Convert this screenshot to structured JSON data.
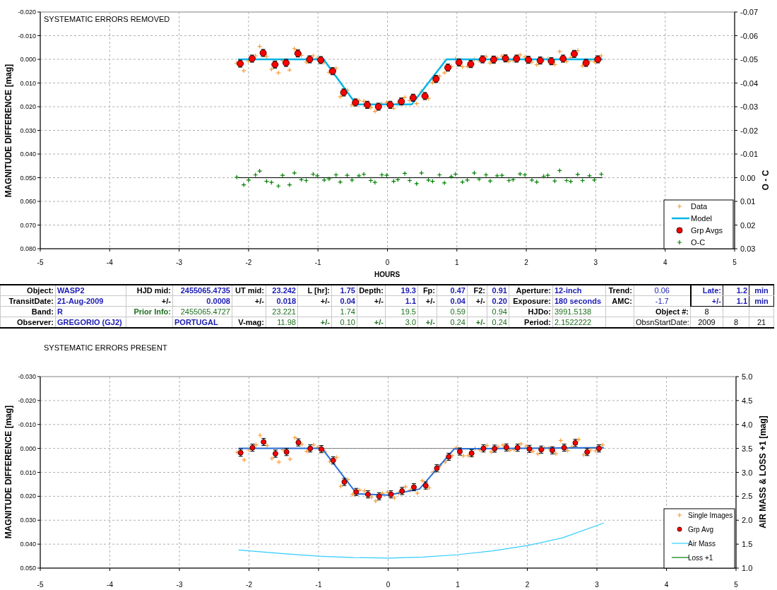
{
  "charts": [
    {
      "chart_data": {
        "type": "scatter",
        "title": "SYSTEMATIC ERRORS REMOVED",
        "xlabel": "HOURS",
        "ylabel": "MAGNITUDE DIFFERENCE [mag]",
        "y2label": "O - C",
        "xlim": [
          -5,
          5
        ],
        "ylim": [
          0.08,
          -0.02
        ],
        "y2lim": [
          0.03,
          -0.07
        ],
        "grid": true,
        "legend": true,
        "xticks": [
          -5,
          -4,
          -3,
          -2,
          -1,
          0,
          1,
          2,
          3,
          4,
          5
        ],
        "yticks": [
          {
            "value": -0.02,
            "label": "-0.020"
          },
          {
            "value": -0.01,
            "label": "-0.010"
          },
          {
            "value": 0,
            "label": "0.000"
          },
          {
            "value": 0.01,
            "label": "0.010"
          },
          {
            "value": 0.02,
            "label": "0.020"
          },
          {
            "value": 0.03,
            "label": "0.030"
          },
          {
            "value": 0.04,
            "label": "0.040"
          },
          {
            "value": 0.05,
            "label": "0.050"
          },
          {
            "value": 0.06,
            "label": "0.060"
          },
          {
            "value": 0.07,
            "label": "0.070"
          },
          {
            "value": 0.08,
            "label": "0.080"
          }
        ],
        "y2ticks": [
          {
            "value": -0.07,
            "label": "-0.07"
          },
          {
            "value": -0.06,
            "label": "-0.06"
          },
          {
            "value": -0.05,
            "label": "-0.05"
          },
          {
            "value": -0.04,
            "label": "-0.04"
          },
          {
            "value": -0.03,
            "label": "-0.03"
          },
          {
            "value": -0.02,
            "label": "-0.02"
          },
          {
            "value": -0.01,
            "label": "-0.01"
          },
          {
            "value": 0,
            "label": "0.00"
          },
          {
            "value": 0.01,
            "label": "0.01"
          },
          {
            "value": 0.02,
            "label": "0.02"
          },
          {
            "value": 0.03,
            "label": "0.03"
          }
        ],
        "series": [
          {
            "type": "line",
            "color": "#000000",
            "axis": "y2",
            "x": [
              -2.15,
              3.1
            ],
            "values": [
              0,
              0
            ]
          },
          {
            "name": "Data",
            "type": "scatter",
            "marker": "plus",
            "color": "#ff9933",
            "axis": "y",
            "x": [
              -2.17,
              -2.07,
              -2.0,
              -1.9,
              -1.84,
              -1.74,
              -1.67,
              -1.57,
              -1.51,
              -1.41,
              -1.34,
              -1.24,
              -1.17,
              -1.07,
              -1.01,
              -0.91,
              -0.84,
              -0.74,
              -0.68,
              -0.58,
              -0.51,
              -0.41,
              -0.34,
              -0.24,
              -0.18,
              -0.08,
              -0.01,
              0.09,
              0.15,
              0.25,
              0.32,
              0.42,
              0.49,
              0.59,
              0.65,
              0.75,
              0.82,
              0.92,
              0.98,
              1.08,
              1.15,
              1.25,
              1.32,
              1.42,
              1.48,
              1.58,
              1.65,
              1.75,
              1.81,
              1.91,
              1.98,
              2.08,
              2.15,
              2.25,
              2.31,
              2.41,
              2.48,
              2.58,
              2.64,
              2.74,
              2.81,
              2.91,
              2.98,
              3.08
            ],
            "values": [
              0.0016,
              0.0048,
              0.0007,
              -0.0015,
              -0.0055,
              -0.0012,
              0.0042,
              0.0057,
              0.0005,
              0.0045,
              -0.0045,
              -0.0017,
              0.0012,
              -0.0015,
              -0.0005,
              0.0013,
              0.0055,
              0.0038,
              0.0158,
              0.013,
              0.0192,
              0.0174,
              0.0177,
              0.0204,
              0.022,
              0.0188,
              0.0182,
              0.0207,
              0.0186,
              0.016,
              0.0174,
              0.0187,
              0.0135,
              0.0165,
              0.0098,
              0.0071,
              0.0057,
              0.003,
              -0.0002,
              0.0031,
              0.003,
              0.0,
              0.0006,
              -0.0012,
              0.0015,
              -0.0007,
              -0.0014,
              0.0008,
              0.0005,
              -0.0019,
              -0.001,
              0.0012,
              0.0023,
              -0.0001,
              -0.0002,
              0.0022,
              -0.0033,
              0.0009,
              -0.0007,
              -0.0037,
              0.0027,
              0.0007,
              0.001,
              -0.0015
            ]
          },
          {
            "name": "Model",
            "type": "line",
            "color": "#00b4e6",
            "axis": "y",
            "x": [
              -2.15,
              -0.92,
              -0.45,
              0.35,
              0.85,
              3.1
            ],
            "values": [
              0,
              0,
              0.019,
              0.019,
              0,
              0
            ]
          },
          {
            "name": "Grp Avgs",
            "type": "scatter",
            "marker": "circle",
            "color": "#ff0000",
            "axis": "y",
            "x": [
              -2.12,
              -1.95,
              -1.79,
              -1.62,
              -1.46,
              -1.29,
              -1.12,
              -0.96,
              -0.79,
              -0.63,
              -0.46,
              -0.29,
              -0.13,
              0.04,
              0.2,
              0.37,
              0.54,
              0.7,
              0.87,
              1.03,
              1.2,
              1.37,
              1.53,
              1.7,
              1.86,
              2.03,
              2.2,
              2.36,
              2.53,
              2.69,
              2.86,
              3.03
            ],
            "values": [
              0.0018,
              -0.0003,
              -0.0027,
              0.0022,
              0.0015,
              -0.0025,
              0.0,
              0.0003,
              0.005,
              0.014,
              0.0182,
              0.0192,
              0.02,
              0.0192,
              0.0178,
              0.0162,
              0.0155,
              0.0083,
              0.0035,
              0.0013,
              0.002,
              0.0,
              0.0001,
              -0.0004,
              -0.0003,
              0.0002,
              0.0005,
              0.0008,
              -0.0003,
              -0.0023,
              0.0015,
              0.0
            ]
          },
          {
            "name": "O-C",
            "type": "scatter",
            "marker": "plus",
            "color": "#008000",
            "axis": "y2",
            "x": [
              -2.17,
              -2.07,
              -2.0,
              -1.9,
              -1.84,
              -1.74,
              -1.67,
              -1.57,
              -1.51,
              -1.41,
              -1.34,
              -1.24,
              -1.17,
              -1.07,
              -1.01,
              -0.91,
              -0.84,
              -0.74,
              -0.68,
              -0.58,
              -0.51,
              -0.41,
              -0.34,
              -0.24,
              -0.18,
              -0.08,
              -0.01,
              0.09,
              0.15,
              0.25,
              0.32,
              0.42,
              0.49,
              0.59,
              0.65,
              0.75,
              0.82,
              0.92,
              0.98,
              1.08,
              1.15,
              1.25,
              1.32,
              1.42,
              1.48,
              1.58,
              1.65,
              1.75,
              1.81,
              1.91,
              1.98,
              2.08,
              2.15,
              2.25,
              2.31,
              2.41,
              2.48,
              2.58,
              2.64,
              2.74,
              2.81,
              2.91,
              2.98,
              3.08
            ],
            "values": [
              -0.0002,
              0.003,
              0.001,
              -0.0012,
              -0.0028,
              0.0015,
              0.002,
              0.0035,
              -0.001,
              0.003,
              -0.002,
              0.0008,
              0.0012,
              -0.0015,
              -0.0008,
              0.001,
              0.0005,
              -0.0012,
              0.0018,
              -0.001,
              0.001,
              -0.0008,
              -0.0015,
              0.0012,
              0.002,
              -0.0012,
              -0.001,
              0.0015,
              0.0008,
              -0.0018,
              0.0012,
              0.0025,
              -0.002,
              0.001,
              0.0015,
              -0.0012,
              0.0022,
              -0.0005,
              -0.0015,
              0.0018,
              0.001,
              -0.002,
              0.0006,
              -0.0012,
              0.0014,
              -0.0008,
              -0.001,
              0.0012,
              0.0008,
              -0.0016,
              -0.0012,
              0.001,
              0.0018,
              -0.0006,
              -0.001,
              0.0014,
              -0.003,
              0.0012,
              0.0016,
              -0.0014,
              0.0012,
              -0.0008,
              0.001,
              -0.0015
            ]
          }
        ]
      }
    },
    {
      "chart_data": {
        "type": "scatter",
        "title": "SYSTEMATIC ERRORS PRESENT",
        "ylabel": "MAGNITUDE DIFFERENCE [mag]",
        "y2label": "AIR MASS & LOSS +1 [mag]",
        "xlim": [
          -5,
          5
        ],
        "ylim": [
          0.05,
          -0.03
        ],
        "y2lim": [
          1,
          5
        ],
        "grid": true,
        "legend": true,
        "xticks": [
          -5,
          -4,
          -3,
          -2,
          -1,
          0,
          1,
          2,
          3,
          4,
          5
        ],
        "yticks": [
          {
            "value": -0.03,
            "label": "-0.030"
          },
          {
            "value": -0.02,
            "label": "-0.020"
          },
          {
            "value": -0.01,
            "label": "-0.010"
          },
          {
            "value": 0,
            "label": "0.000"
          },
          {
            "value": 0.01,
            "label": "0.010"
          },
          {
            "value": 0.02,
            "label": "0.020"
          },
          {
            "value": 0.03,
            "label": "0.030"
          },
          {
            "value": 0.04,
            "label": "0.040"
          },
          {
            "value": 0.05,
            "label": "0.050"
          }
        ],
        "y2ticks": [
          {
            "value": 5,
            "label": "5.0"
          },
          {
            "value": 4.5,
            "label": "4.5"
          },
          {
            "value": 4,
            "label": "4.0"
          },
          {
            "value": 3.5,
            "label": "3.5"
          },
          {
            "value": 3,
            "label": "3.0"
          },
          {
            "value": 2.5,
            "label": "2.5"
          },
          {
            "value": 2,
            "label": "2.0"
          },
          {
            "value": 1.5,
            "label": "1.5"
          },
          {
            "value": 1,
            "label": "1.0"
          }
        ],
        "series": [
          {
            "type": "line",
            "color": "#808080",
            "axis": "y",
            "x": [
              -2.15,
              3.1
            ],
            "values": [
              0,
              0
            ]
          },
          {
            "name": "Single Images",
            "type": "scatter",
            "marker": "plus",
            "color": "#ff9933",
            "axis": "y",
            "x": [
              -2.17,
              -2.07,
              -2.0,
              -1.9,
              -1.84,
              -1.74,
              -1.67,
              -1.57,
              -1.51,
              -1.41,
              -1.34,
              -1.24,
              -1.17,
              -1.07,
              -1.01,
              -0.91,
              -0.84,
              -0.74,
              -0.68,
              -0.58,
              -0.51,
              -0.41,
              -0.34,
              -0.24,
              -0.18,
              -0.08,
              -0.01,
              0.09,
              0.15,
              0.25,
              0.32,
              0.42,
              0.49,
              0.59,
              0.65,
              0.75,
              0.82,
              0.92,
              0.98,
              1.08,
              1.15,
              1.25,
              1.32,
              1.42,
              1.48,
              1.58,
              1.65,
              1.75,
              1.81,
              1.91,
              1.98,
              2.08,
              2.15,
              2.25,
              2.31,
              2.41,
              2.48,
              2.58,
              2.64,
              2.74,
              2.81,
              2.91,
              2.98,
              3.08
            ],
            "values": [
              0.0016,
              0.0048,
              0.0007,
              -0.0015,
              -0.0055,
              -0.0012,
              0.0042,
              0.0057,
              0.0005,
              0.0045,
              -0.0045,
              -0.0017,
              0.0012,
              -0.0015,
              -0.0005,
              0.0013,
              0.0055,
              0.0038,
              0.0158,
              0.013,
              0.0192,
              0.0174,
              0.0177,
              0.0204,
              0.022,
              0.0188,
              0.0182,
              0.0207,
              0.0186,
              0.016,
              0.0174,
              0.0187,
              0.0135,
              0.0165,
              0.0098,
              0.0071,
              0.0057,
              0.003,
              -0.0002,
              0.0031,
              0.003,
              0.0,
              0.0006,
              -0.0012,
              0.0015,
              -0.0007,
              -0.0014,
              0.0008,
              0.0005,
              -0.0019,
              -0.001,
              0.0012,
              0.0023,
              -0.0001,
              -0.0002,
              0.0022,
              -0.0033,
              0.0009,
              -0.0007,
              -0.0037,
              0.0027,
              0.0007,
              0.001,
              -0.0015
            ]
          },
          {
            "type": "line",
            "color": "#2a6fd6",
            "axis": "y",
            "x": [
              -2.15,
              -0.95,
              -0.45,
              0.0,
              0.45,
              0.95,
              3.1
            ],
            "values": [
              0,
              0,
              0.019,
              0.0195,
              0.017,
              0.0002,
              -0.0003
            ]
          },
          {
            "name": "Grp Avg",
            "type": "scatter",
            "marker": "circle",
            "color": "#ff0000",
            "axis": "y",
            "x": [
              -2.12,
              -1.95,
              -1.79,
              -1.62,
              -1.46,
              -1.29,
              -1.12,
              -0.96,
              -0.79,
              -0.63,
              -0.46,
              -0.29,
              -0.13,
              0.04,
              0.2,
              0.37,
              0.54,
              0.7,
              0.87,
              1.03,
              1.2,
              1.37,
              1.53,
              1.7,
              1.86,
              2.03,
              2.2,
              2.36,
              2.53,
              2.69,
              2.86,
              3.03
            ],
            "values": [
              0.0018,
              -0.0003,
              -0.0027,
              0.0022,
              0.0015,
              -0.0025,
              0.0,
              0.0003,
              0.005,
              0.014,
              0.0182,
              0.0192,
              0.02,
              0.0192,
              0.0178,
              0.0162,
              0.0155,
              0.0083,
              0.0035,
              0.0013,
              0.002,
              0.0,
              0.0001,
              -0.0004,
              -0.0003,
              0.0002,
              0.0005,
              0.0008,
              -0.0003,
              -0.0023,
              0.0015,
              0.0
            ]
          },
          {
            "name": "Air Mass",
            "type": "line",
            "color": "#33ccff",
            "axis": "y2",
            "x": [
              -2.15,
              -1.5,
              -1,
              -0.5,
              0,
              0.5,
              1,
              1.5,
              2,
              2.5,
              3.1
            ],
            "values": [
              1.38,
              1.3,
              1.25,
              1.22,
              1.21,
              1.23,
              1.28,
              1.36,
              1.47,
              1.63,
              1.94
            ]
          },
          {
            "name": "Loss +1",
            "type": "line",
            "color": "#008000"
          }
        ]
      }
    }
  ],
  "table": {
    "rows": [
      [
        {
          "text": "Object:",
          "kind": "label"
        },
        {
          "text": "WASP2",
          "kind": "text"
        },
        {
          "text": "HJD mid:",
          "kind": "label"
        },
        {
          "text": "2455065.4735",
          "kind": "value"
        },
        {
          "text": "UT mid:",
          "kind": "label"
        },
        {
          "text": "23.242",
          "kind": "value"
        },
        {
          "text": "L [hr]:",
          "kind": "label"
        },
        {
          "text": "1.75",
          "kind": "value"
        },
        {
          "text": "Depth:",
          "kind": "label"
        },
        {
          "text": "19.3",
          "kind": "value"
        },
        {
          "text": "Fp:",
          "kind": "label"
        },
        {
          "text": "0.47",
          "kind": "value"
        },
        {
          "text": "F2:",
          "kind": "label"
        },
        {
          "text": "0.91",
          "kind": "value"
        },
        {
          "text": "Aperture:",
          "kind": "label"
        },
        {
          "text": "12-inch",
          "kind": "text"
        },
        {
          "text": "Trend:",
          "kind": "label"
        },
        {
          "text": "0.06",
          "kind": "plain_blue"
        },
        {
          "text": "Late:",
          "kind": "blue_label"
        },
        {
          "text": "1.2",
          "kind": "value"
        },
        {
          "text": "min",
          "kind": "unit"
        }
      ],
      [
        {
          "text": "TransitDate:",
          "kind": "label"
        },
        {
          "text": "21-Aug-2009",
          "kind": "text"
        },
        {
          "text": "+/-",
          "kind": "label"
        },
        {
          "text": "0.0008",
          "kind": "value"
        },
        {
          "text": "+/-",
          "kind": "label"
        },
        {
          "text": "0.018",
          "kind": "value"
        },
        {
          "text": "+/-",
          "kind": "label"
        },
        {
          "text": "0.04",
          "kind": "value"
        },
        {
          "text": "+/-",
          "kind": "label"
        },
        {
          "text": "1.1",
          "kind": "value"
        },
        {
          "text": "+/-",
          "kind": "label"
        },
        {
          "text": "0.04",
          "kind": "value"
        },
        {
          "text": "+/-",
          "kind": "label"
        },
        {
          "text": "0.20",
          "kind": "value"
        },
        {
          "text": "Exposure:",
          "kind": "label"
        },
        {
          "text": "180 seconds",
          "kind": "text"
        },
        {
          "text": "AMC:",
          "kind": "label"
        },
        {
          "text": "-1.7",
          "kind": "plain_blue"
        },
        {
          "text": "+/-",
          "kind": "blue_label"
        },
        {
          "text": "1.1",
          "kind": "value"
        },
        {
          "text": "min",
          "kind": "unit"
        }
      ],
      [
        {
          "text": "Band:",
          "kind": "label"
        },
        {
          "text": "R",
          "kind": "text"
        },
        {
          "text": "Prior Info:",
          "kind": "prior_label"
        },
        {
          "text": "2455065.4727",
          "kind": "prior"
        },
        {
          "kind": "blank"
        },
        {
          "text": "23.221",
          "kind": "prior"
        },
        {
          "kind": "blank"
        },
        {
          "text": "1.74",
          "kind": "prior"
        },
        {
          "kind": "blank"
        },
        {
          "text": "19.5",
          "kind": "prior"
        },
        {
          "kind": "blank"
        },
        {
          "text": "0.59",
          "kind": "prior"
        },
        {
          "kind": "blank"
        },
        {
          "text": "0.94",
          "kind": "prior"
        },
        {
          "text": "HJDo:",
          "kind": "label"
        },
        {
          "text": "3991.5138",
          "kind": "prior_text"
        },
        {
          "kind": "blank"
        },
        {
          "text": "Object #:",
          "kind": "label"
        },
        {
          "text": "8",
          "kind": "plain"
        },
        {
          "kind": "blank"
        },
        {
          "kind": "blank"
        }
      ],
      [
        {
          "text": "Observer:",
          "kind": "label"
        },
        {
          "text": "GREGORIO (GJ2)",
          "kind": "text"
        },
        {
          "kind": "blank"
        },
        {
          "text": "PORTUGAL",
          "kind": "text"
        },
        {
          "text": "V-mag:",
          "kind": "label"
        },
        {
          "text": "11.98",
          "kind": "prior"
        },
        {
          "text": "+/-",
          "kind": "prior_label"
        },
        {
          "text": "0.10",
          "kind": "prior"
        },
        {
          "text": "+/-",
          "kind": "prior_label"
        },
        {
          "text": "3.0",
          "kind": "prior"
        },
        {
          "text": "+/-",
          "kind": "prior_label"
        },
        {
          "text": "0.24",
          "kind": "prior"
        },
        {
          "text": "+/-",
          "kind": "prior_label"
        },
        {
          "text": "0.24",
          "kind": "prior"
        },
        {
          "text": "Period:",
          "kind": "label"
        },
        {
          "text": "2.1522222",
          "kind": "prior_text"
        },
        {
          "kind": "blank"
        },
        {
          "text": "ObsnStartDate:",
          "kind": "plain_right"
        },
        {
          "text": "2009",
          "kind": "plain"
        },
        {
          "text": "8",
          "kind": "plain"
        },
        {
          "text": "21",
          "kind": "plain"
        }
      ]
    ]
  }
}
